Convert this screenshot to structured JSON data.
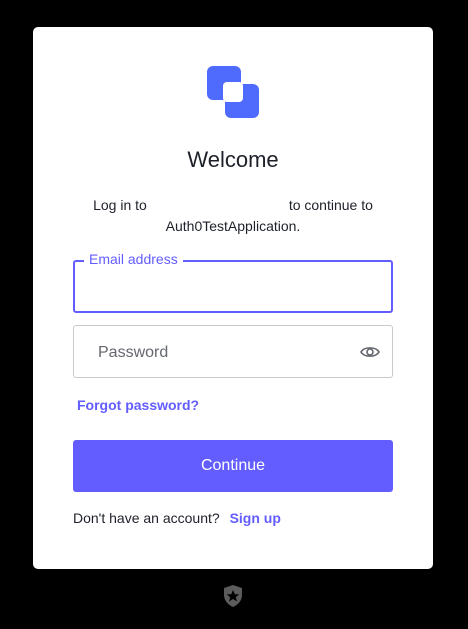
{
  "header": {
    "title": "Welcome"
  },
  "intro": {
    "prefix": "Log in to",
    "suffix": "to continue to",
    "app_name": "Auth0TestApplication."
  },
  "form": {
    "email_label": "Email address",
    "email_value": "",
    "password_placeholder": "Password",
    "password_value": "",
    "forgot_label": "Forgot password?",
    "continue_label": "Continue"
  },
  "signup": {
    "prompt": "Don't have an account?",
    "link_label": "Sign up"
  },
  "colors": {
    "accent": "#635dff",
    "logo": "#4f6bfe",
    "background": "#000000",
    "card": "#ffffff"
  },
  "icons": {
    "logo": "brand-logo-icon",
    "password_toggle": "eye-icon",
    "footer": "auth0-shield-icon"
  }
}
